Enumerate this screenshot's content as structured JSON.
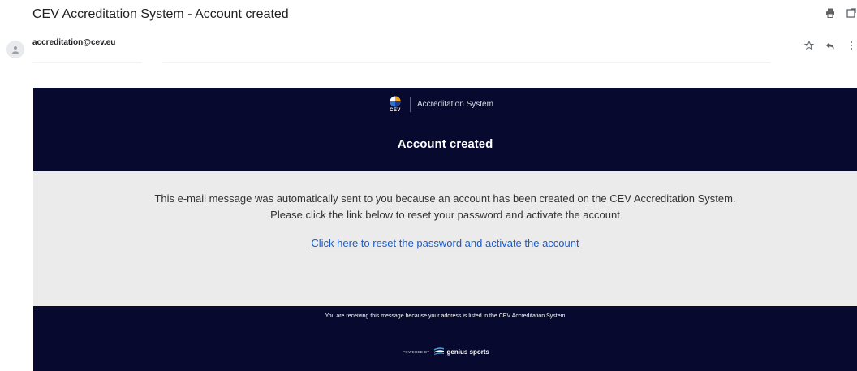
{
  "email": {
    "subject": "CEV Accreditation System - Account created",
    "sender": "accreditation@cev.eu"
  },
  "toolbar_icons": [
    "print-icon",
    "open-in-new-window-icon"
  ],
  "sender_actions": [
    "star-icon",
    "reply-icon",
    "more-options-icon"
  ],
  "message": {
    "brand_caption": "CEV",
    "brand_name": "Accreditation System",
    "title": "Account created",
    "body_line1": "This e-mail message was automatically sent to you because an account has been created on the CEV Accreditation System.",
    "body_line2": "Please click the link below to reset your password and activate the account",
    "link_text": "Click here to reset the password and activate the account",
    "footer_note": "You are receiving this message because your address is listed in the CEV Accreditation System",
    "powered_by": "POWERED BY",
    "powered_brand": "genius sports"
  },
  "colors": {
    "header_bg": "#070a2e",
    "body_bg": "#ebebeb",
    "link": "#1a5ccf",
    "logo_orange": "#f5a623",
    "logo_blue": "#2f6fd6"
  }
}
